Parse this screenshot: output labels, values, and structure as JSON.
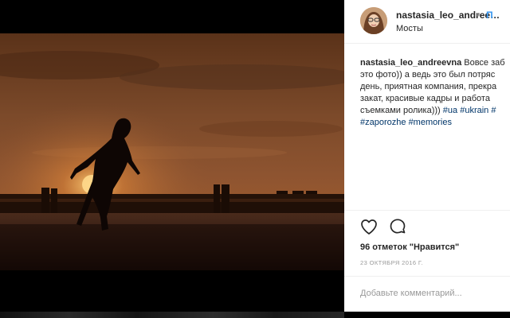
{
  "post": {
    "username": "nastasia_leo_andree…",
    "follow_label": "П",
    "dot": "•",
    "location": "Мосты",
    "caption": {
      "username": "nastasia_leo_andreevna",
      "lines": [
        "Вовсе заб",
        "это фото)) а ведь это был потряс",
        "день, приятная компания, прекра",
        "закат, красивые кадры и работа",
        "съемками ролика)))"
      ],
      "line5_tags": [
        "#ua",
        "#ukrain",
        "#"
      ],
      "line6_tags": [
        "#zaporozhe",
        "#memories"
      ]
    },
    "likes": "96 отметок \"Нравится\"",
    "date": "23 октября 2016 г.",
    "comment_placeholder": "Добавьте комментарий..."
  },
  "icons": {
    "like": "heart-icon",
    "comment": "speech-bubble-icon"
  },
  "colors": {
    "link": "#3897f0",
    "hashtag": "#003569",
    "text": "#262626",
    "muted": "#999999",
    "sky": "#7a4a2a",
    "sun": "#f7b24c"
  }
}
